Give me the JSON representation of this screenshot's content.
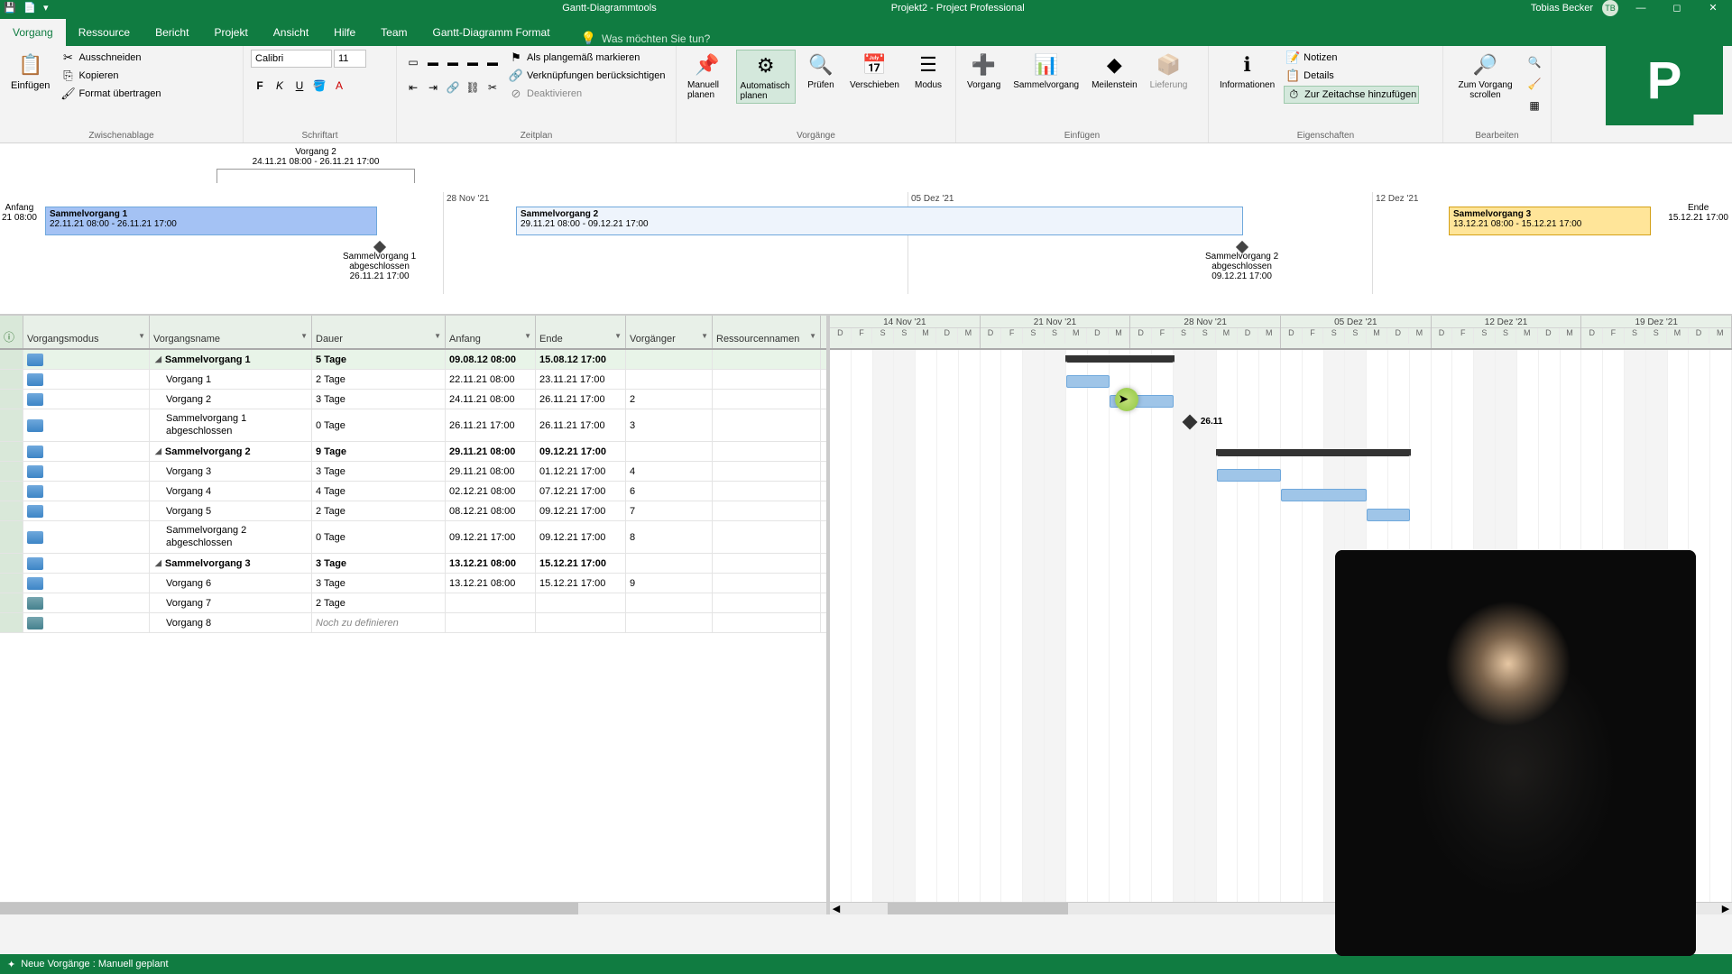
{
  "titlebar": {
    "tools_label": "Gantt-Diagrammtools",
    "doc_title": "Projekt2 - Project Professional",
    "user_name": "Tobias Becker",
    "user_initials": "TB"
  },
  "tabs": {
    "items": [
      "Vorgang",
      "Ressource",
      "Bericht",
      "Projekt",
      "Ansicht",
      "Hilfe",
      "Team",
      "Gantt-Diagramm Format"
    ],
    "active_index": 0,
    "tell_me": "Was möchten Sie tun?"
  },
  "ribbon": {
    "clipboard": {
      "label": "Zwischenablage",
      "paste": "Einfügen",
      "cut": "Ausschneiden",
      "copy": "Kopieren",
      "format_painter": "Format übertragen"
    },
    "font": {
      "label": "Schriftart",
      "name": "Calibri",
      "size": "11"
    },
    "schedule": {
      "label": "Zeitplan",
      "on_track": "Als plangemäß markieren",
      "respect_links": "Verknüpfungen berücksichtigen",
      "deactivate": "Deaktivieren"
    },
    "tasks": {
      "label": "Vorgänge",
      "manual": "Manuell planen",
      "auto": "Automatisch planen",
      "inspect": "Prüfen",
      "move": "Verschieben",
      "mode": "Modus"
    },
    "insert": {
      "label": "Einfügen",
      "task": "Vorgang",
      "summary": "Sammelvorgang",
      "milestone": "Meilenstein",
      "deliverable": "Lieferung"
    },
    "properties": {
      "label": "Eigenschaften",
      "information": "Informationen",
      "notes": "Notizen",
      "details": "Details",
      "add_timeline": "Zur Zeitachse hinzufügen"
    },
    "edit": {
      "label": "Bearbeiten",
      "scroll_to": "Zum Vorgang scrollen"
    }
  },
  "timeline": {
    "top_marker": {
      "name": "Vorgang 2",
      "range": "24.11.21 08:00 - 26.11.21 17:00"
    },
    "start_label": "Anfang",
    "start_date": "21 08:00",
    "end_label": "Ende",
    "end_date": "15.12.21 17:00",
    "ticks": [
      {
        "label": "28 Nov '21",
        "pos": 495
      },
      {
        "label": "05 Dez '21",
        "pos": 1010
      },
      {
        "label": "12 Dez '21",
        "pos": 1525
      }
    ],
    "bars": [
      {
        "title": "Sammelvorgang 1",
        "range": "22.11.21 08:00 - 26.11.21 17:00"
      },
      {
        "title": "Sammelvorgang 2",
        "range": "29.11.21 08:00 - 09.12.21 17:00"
      },
      {
        "title": "Sammelvorgang 3",
        "range": "13.12.21 08:00 - 15.12.21 17:00"
      }
    ],
    "milestones": [
      {
        "line1": "Sammelvorgang 1",
        "line2": "abgeschlossen",
        "date": "26.11.21 17:00",
        "pos": 410
      },
      {
        "line1": "Sammelvorgang 2",
        "line2": "abgeschlossen",
        "date": "09.12.21 17:00",
        "pos": 1370
      }
    ]
  },
  "grid": {
    "headers": {
      "info": "ⓘ",
      "mode": "Vorgangsmodus",
      "name": "Vorgangsname",
      "duration": "Dauer",
      "start": "Anfang",
      "end": "Ende",
      "predecessors": "Vorgänger",
      "resources": "Ressourcennamen"
    },
    "rows": [
      {
        "type": "summary",
        "name": "Sammelvorgang 1",
        "dur": "5 Tage",
        "start": "09.08.12 08:00",
        "end": "15.08.12 17:00",
        "pred": ""
      },
      {
        "type": "task",
        "name": "Vorgang 1",
        "dur": "2 Tage",
        "start": "22.11.21 08:00",
        "end": "23.11.21 17:00",
        "pred": ""
      },
      {
        "type": "task",
        "name": "Vorgang 2",
        "dur": "3 Tage",
        "start": "24.11.21 08:00",
        "end": "26.11.21 17:00",
        "pred": "2"
      },
      {
        "type": "milestone",
        "name": "Sammelvorgang 1 abgeschlossen",
        "dur": "0 Tage",
        "start": "26.11.21 17:00",
        "end": "26.11.21 17:00",
        "pred": "3"
      },
      {
        "type": "summary",
        "name": "Sammelvorgang 2",
        "dur": "9 Tage",
        "start": "29.11.21 08:00",
        "end": "09.12.21 17:00",
        "pred": ""
      },
      {
        "type": "task",
        "name": "Vorgang 3",
        "dur": "3 Tage",
        "start": "29.11.21 08:00",
        "end": "01.12.21 17:00",
        "pred": "4"
      },
      {
        "type": "task",
        "name": "Vorgang 4",
        "dur": "4 Tage",
        "start": "02.12.21 08:00",
        "end": "07.12.21 17:00",
        "pred": "6"
      },
      {
        "type": "task",
        "name": "Vorgang 5",
        "dur": "2 Tage",
        "start": "08.12.21 08:00",
        "end": "09.12.21 17:00",
        "pred": "7"
      },
      {
        "type": "milestone",
        "name": "Sammelvorgang 2 abgeschlossen",
        "dur": "0 Tage",
        "start": "09.12.21 17:00",
        "end": "09.12.21 17:00",
        "pred": "8"
      },
      {
        "type": "summary",
        "name": "Sammelvorgang 3",
        "dur": "3 Tage",
        "start": "13.12.21 08:00",
        "end": "15.12.21 17:00",
        "pred": ""
      },
      {
        "type": "task",
        "name": "Vorgang 6",
        "dur": "3 Tage",
        "start": "13.12.21 08:00",
        "end": "15.12.21 17:00",
        "pred": "9"
      },
      {
        "type": "manual",
        "name": "Vorgang 7",
        "dur": "2 Tage",
        "start": "",
        "end": "",
        "pred": ""
      },
      {
        "type": "manual",
        "name": "Vorgang 8",
        "dur": "Noch zu definieren",
        "start": "",
        "end": "",
        "pred": "",
        "italic": true
      }
    ]
  },
  "gantt": {
    "weeks": [
      "14 Nov '21",
      "21 Nov '21",
      "28 Nov '21",
      "05 Dez '21",
      "12 Dez '21",
      "19 Dez '21"
    ],
    "days": [
      "D",
      "F",
      "S",
      "S",
      "M",
      "D",
      "M"
    ],
    "milestone_label": "26.11"
  },
  "statusbar": {
    "text": "Neue Vorgänge : Manuell geplant"
  }
}
